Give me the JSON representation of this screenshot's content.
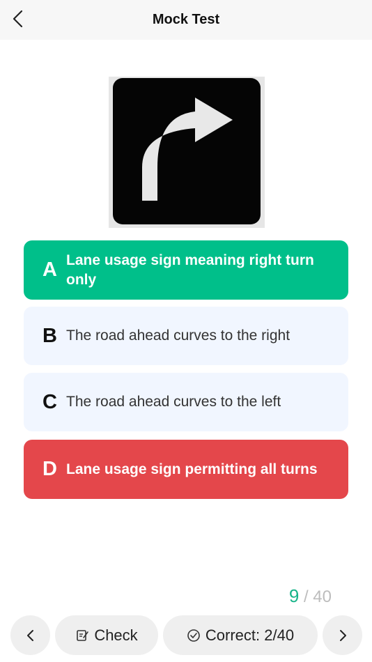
{
  "header": {
    "title": "Mock Test",
    "back_icon": "chevron-left-icon"
  },
  "question": {
    "sign_icon": "right-turn-arrow-sign"
  },
  "options": [
    {
      "letter": "A",
      "text": "Lane usage sign meaning right turn only",
      "state": "correct",
      "color": "#00bf8a"
    },
    {
      "letter": "B",
      "text": "The road ahead curves to the right",
      "state": "neutral",
      "color": "#f1f6ff"
    },
    {
      "letter": "C",
      "text": "The road ahead curves to the left",
      "state": "neutral",
      "color": "#f1f6ff"
    },
    {
      "letter": "D",
      "text": "Lane usage sign permitting all turns",
      "state": "wrong",
      "color": "#e4474b"
    }
  ],
  "progress": {
    "current": "9",
    "separator": "/",
    "total": "40"
  },
  "bottom_bar": {
    "prev_icon": "chevron-left-icon",
    "check_label": "Check",
    "check_icon": "edit-note-icon",
    "correct_label": "Correct: 2/40",
    "correct_icon": "check-circle-icon",
    "next_icon": "chevron-right-icon"
  }
}
